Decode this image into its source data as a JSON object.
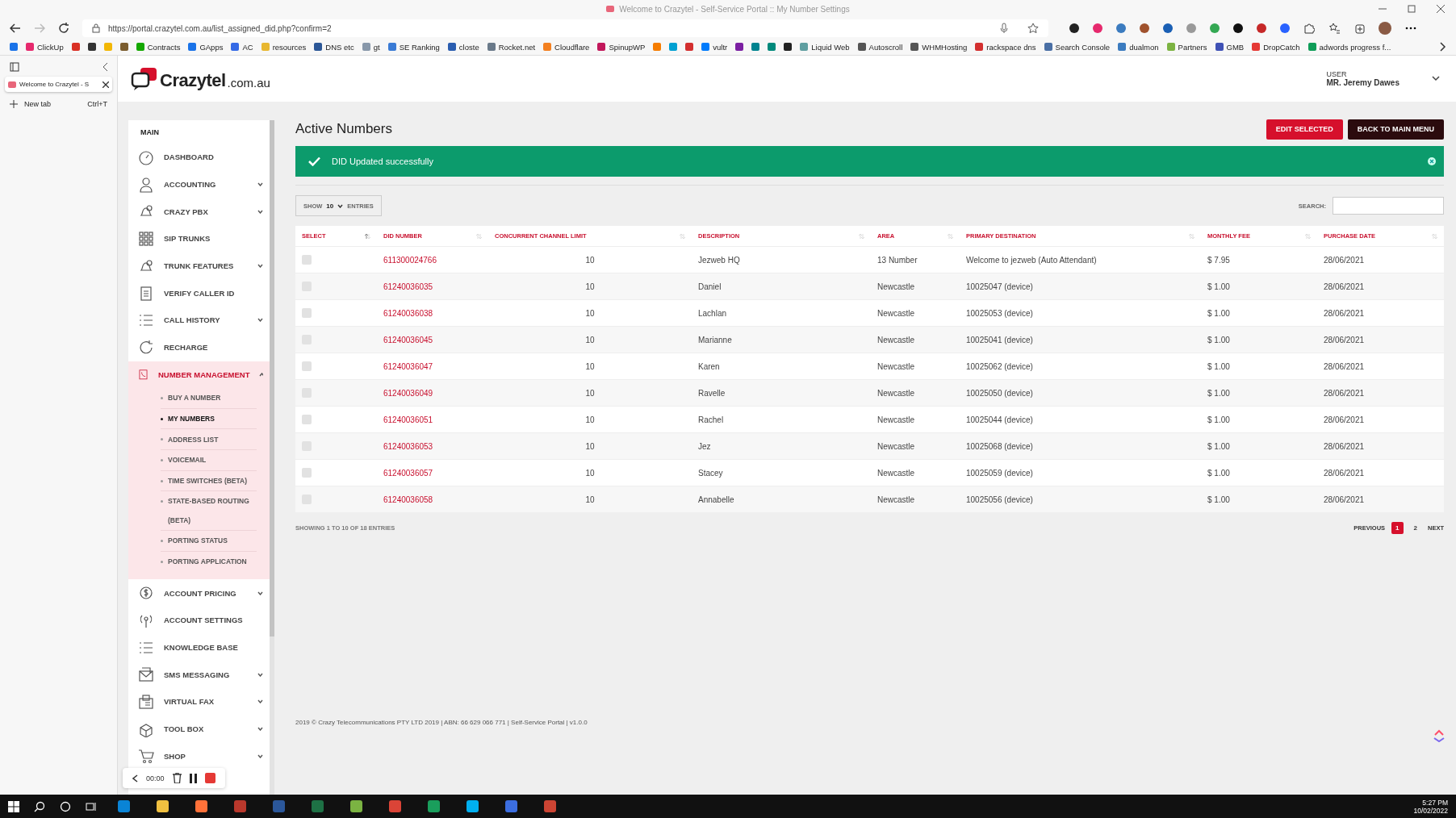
{
  "browser": {
    "title": "Welcome to Crazytel - Self-Service Portal :: My Number Settings",
    "url": "https://portal.crazytel.com.au/list_assigned_did.php?confirm=2",
    "bookmarks": [
      {
        "color": "#1a73e8"
      },
      {
        "label": "ClickUp",
        "color": "#e6296d"
      },
      {
        "color": "#d93025"
      },
      {
        "color": "#333333"
      },
      {
        "color": "#f2b705"
      },
      {
        "color": "#7a5c2e"
      },
      {
        "label": "Contracts",
        "color": "#14a800"
      },
      {
        "label": "GApps",
        "color": "#1a73e8"
      },
      {
        "label": "AC",
        "color": "#356ae6"
      },
      {
        "label": "resources",
        "color": "#e8b730"
      },
      {
        "label": "DNS etc",
        "color": "#2b5797"
      },
      {
        "label": "gt",
        "color": "#8898aa"
      },
      {
        "label": "SE Ranking",
        "color": "#3a7bd5"
      },
      {
        "label": "closte",
        "color": "#2a5db0"
      },
      {
        "label": "Rocket.net",
        "color": "#6a7a8a"
      },
      {
        "label": "Cloudflare",
        "color": "#f38020"
      },
      {
        "label": "SpinupWP",
        "color": "#c2185b"
      },
      {
        "color": "#f57c00"
      },
      {
        "color": "#00a0d2"
      },
      {
        "color": "#d32f2f"
      },
      {
        "label": "vultr",
        "color": "#007bfc"
      },
      {
        "color": "#7b1fa2"
      },
      {
        "color": "#00838f"
      },
      {
        "color": "#00897b"
      },
      {
        "color": "#222222"
      },
      {
        "label": "Liquid Web",
        "color": "#5f9ea0"
      },
      {
        "label": "Autoscroll",
        "color": "#555555"
      },
      {
        "label": "WHMHosting",
        "color": "#555555"
      },
      {
        "label": "rackspace dns",
        "color": "#d32f2f"
      },
      {
        "label": "Search Console",
        "color": "#4a6fa5"
      },
      {
        "label": "dualmon",
        "color": "#3b7bbf"
      },
      {
        "label": "Partners",
        "color": "#7cb342"
      },
      {
        "label": "GMB",
        "color": "#3f51b5"
      },
      {
        "label": "DropCatch",
        "color": "#e53935"
      },
      {
        "label": "adwords progress f...",
        "color": "#0f9d58"
      }
    ]
  },
  "vertical_tabs": {
    "tabs": [
      {
        "label": "Welcome to Crazytel - S",
        "selected": true
      }
    ],
    "new_tab": {
      "label": "New tab",
      "shortcut": "Ctrl+T"
    }
  },
  "header": {
    "logo": {
      "brand": "Crazytel",
      "suffix": ".com.au"
    },
    "user": {
      "label": "USER",
      "name": "MR. Jeremy Dawes"
    }
  },
  "sidebar": {
    "section": "MAIN",
    "items": [
      {
        "label": "DASHBOARD",
        "expandable": false,
        "expanded": false
      },
      {
        "label": "ACCOUNTING",
        "expandable": true,
        "expanded": false
      },
      {
        "label": "CRAZY PBX",
        "expandable": true,
        "expanded": false
      },
      {
        "label": "SIP TRUNKS",
        "expandable": false,
        "expanded": false
      },
      {
        "label": "TRUNK FEATURES",
        "expandable": true,
        "expanded": false
      },
      {
        "label": "VERIFY CALLER ID",
        "expandable": false,
        "expanded": false
      },
      {
        "label": "CALL HISTORY",
        "expandable": true,
        "expanded": false
      },
      {
        "label": "RECHARGE",
        "expandable": false,
        "expanded": false
      },
      {
        "label": "NUMBER MANAGEMENT",
        "expandable": true,
        "expanded": true,
        "children": [
          {
            "label": "BUY A NUMBER",
            "selected": false
          },
          {
            "label": "MY NUMBERS",
            "selected": true
          },
          {
            "label": "ADDRESS LIST",
            "selected": false
          },
          {
            "label": "VOICEMAIL",
            "selected": false
          },
          {
            "label": "TIME SWITCHES (BETA)",
            "selected": false
          },
          {
            "label": "STATE-BASED ROUTING (BETA)",
            "selected": false
          },
          {
            "label": "PORTING STATUS",
            "selected": false
          },
          {
            "label": "PORTING APPLICATION",
            "selected": false
          }
        ]
      },
      {
        "label": "ACCOUNT PRICING",
        "expandable": true,
        "expanded": false
      },
      {
        "label": "ACCOUNT SETTINGS",
        "expandable": false,
        "expanded": false
      },
      {
        "label": "KNOWLEDGE BASE",
        "expandable": false,
        "expanded": false
      },
      {
        "label": "SMS MESSAGING",
        "expandable": true,
        "expanded": false
      },
      {
        "label": "VIRTUAL FAX",
        "expandable": true,
        "expanded": false
      },
      {
        "label": "TOOL BOX",
        "expandable": true,
        "expanded": false
      },
      {
        "label": "SHOP",
        "expandable": true,
        "expanded": false
      }
    ]
  },
  "page": {
    "title": "Active Numbers",
    "buttons": [
      {
        "label": "EDIT SELECTED",
        "kind": "primary"
      },
      {
        "label": "BACK TO MAIN MENU",
        "kind": "dark"
      }
    ],
    "alert": {
      "text": "DID Updated successfully"
    },
    "length_menu": {
      "show": "SHOW",
      "value": "10",
      "entries": "ENTRIES"
    },
    "search": {
      "label": "SEARCH:"
    },
    "table": {
      "columns": [
        "SELECT",
        "DID NUMBER",
        "CONCURRENT CHANNEL LIMIT",
        "DESCRIPTION",
        "AREA",
        "PRIMARY DESTINATION",
        "MONTHLY FEE",
        "PURCHASE DATE"
      ],
      "rows": [
        {
          "selected": false,
          "did": "611300024766",
          "limit": "10",
          "description": "Jezweb HQ",
          "area": "13 Number",
          "destination": "Welcome to jezweb (Auto Attendant)",
          "fee": "$ 7.95",
          "date": "28/06/2021"
        },
        {
          "selected": false,
          "did": "61240036035",
          "limit": "10",
          "description": "Daniel",
          "area": "Newcastle",
          "destination": "10025047 (device)",
          "fee": "$ 1.00",
          "date": "28/06/2021"
        },
        {
          "selected": false,
          "did": "61240036038",
          "limit": "10",
          "description": "Lachlan",
          "area": "Newcastle",
          "destination": "10025053 (device)",
          "fee": "$ 1.00",
          "date": "28/06/2021"
        },
        {
          "selected": false,
          "did": "61240036045",
          "limit": "10",
          "description": "Marianne",
          "area": "Newcastle",
          "destination": "10025041 (device)",
          "fee": "$ 1.00",
          "date": "28/06/2021"
        },
        {
          "selected": false,
          "did": "61240036047",
          "limit": "10",
          "description": "Karen",
          "area": "Newcastle",
          "destination": "10025062 (device)",
          "fee": "$ 1.00",
          "date": "28/06/2021"
        },
        {
          "selected": false,
          "did": "61240036049",
          "limit": "10",
          "description": "Ravelle",
          "area": "Newcastle",
          "destination": "10025050 (device)",
          "fee": "$ 1.00",
          "date": "28/06/2021"
        },
        {
          "selected": false,
          "did": "61240036051",
          "limit": "10",
          "description": "Rachel",
          "area": "Newcastle",
          "destination": "10025044 (device)",
          "fee": "$ 1.00",
          "date": "28/06/2021"
        },
        {
          "selected": false,
          "did": "61240036053",
          "limit": "10",
          "description": "Jez",
          "area": "Newcastle",
          "destination": "10025068 (device)",
          "fee": "$ 1.00",
          "date": "28/06/2021"
        },
        {
          "selected": false,
          "did": "61240036057",
          "limit": "10",
          "description": "Stacey",
          "area": "Newcastle",
          "destination": "10025059 (device)",
          "fee": "$ 1.00",
          "date": "28/06/2021"
        },
        {
          "selected": false,
          "did": "61240036058",
          "limit": "10",
          "description": "Annabelle",
          "area": "Newcastle",
          "destination": "10025056 (device)",
          "fee": "$ 1.00",
          "date": "28/06/2021"
        }
      ]
    },
    "info": "SHOWING 1 TO 10 OF 18 ENTRIES",
    "pagination": {
      "previous": "PREVIOUS",
      "pages": [
        {
          "label": "1",
          "selected": true
        },
        {
          "label": "2",
          "selected": false
        }
      ],
      "next": "NEXT"
    },
    "footer": "2019 © Crazy Telecommunications PTY LTD 2019 | ABN: 66 629 066 771 | Self-Service Portal | v1.0.0"
  },
  "recorder": {
    "time": "00:00"
  },
  "taskbar": {
    "time": "5:27 PM",
    "date": "10/02/2022"
  }
}
